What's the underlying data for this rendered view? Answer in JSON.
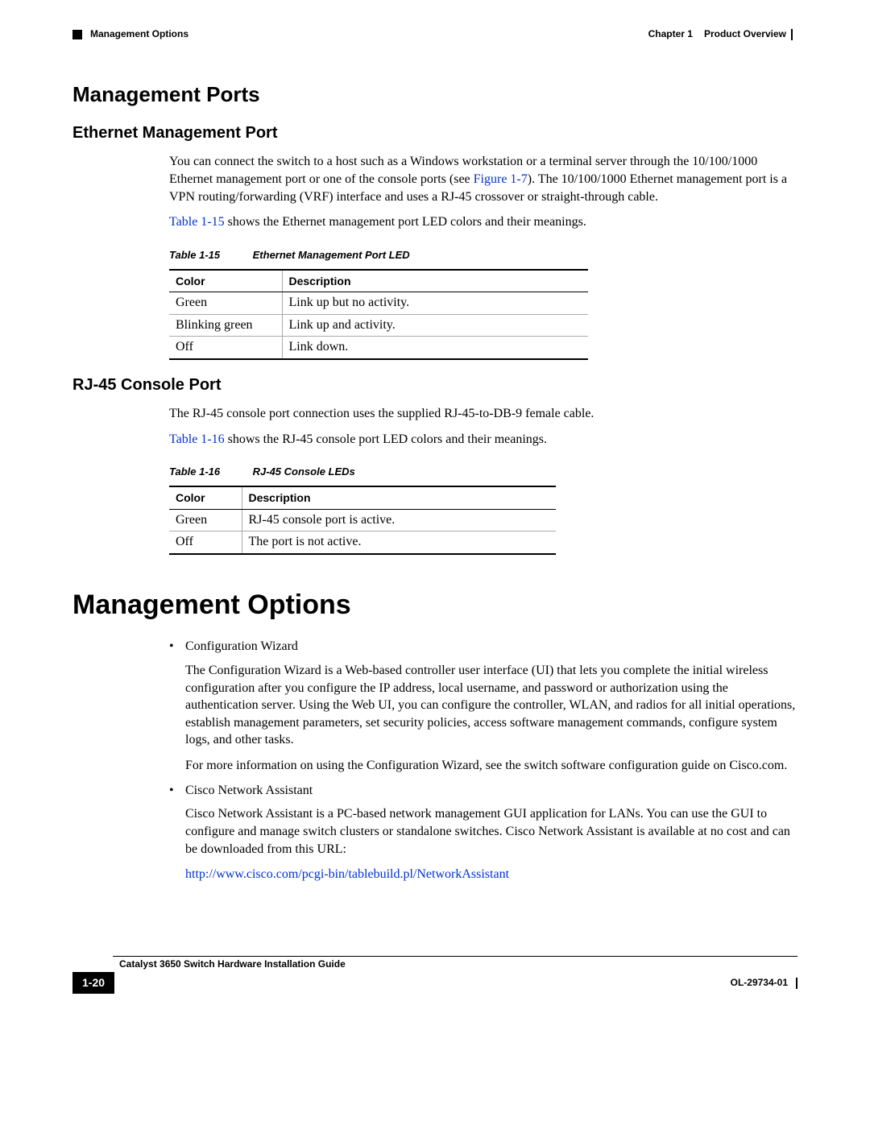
{
  "header": {
    "section": "Management Options",
    "chapter_label": "Chapter 1",
    "chapter_title": "Product Overview"
  },
  "h2_ports": "Management Ports",
  "h3_ethernet": "Ethernet Management Port",
  "ethernet": {
    "p1_a": "You can connect the switch to a host such as a Windows workstation or a terminal server through the 10/100/1000 Ethernet management port or one of the console ports (see ",
    "p1_link": "Figure 1-7",
    "p1_b": "). The 10/100/1000 Ethernet management port is a VPN routing/forwarding (VRF) interface and uses a RJ-45 crossover or straight-through cable.",
    "p2_link": "Table 1-15",
    "p2_b": " shows the Ethernet management port LED colors and their meanings."
  },
  "table15": {
    "caption_label": "Table 1-15",
    "caption_title": "Ethernet Management Port LED",
    "col1": "Color",
    "col2": "Description",
    "r1c1": "Green",
    "r1c2": "Link up but no activity.",
    "r2c1": "Blinking green",
    "r2c2": "Link up and activity.",
    "r3c1": "Off",
    "r3c2": "Link down."
  },
  "h3_rj45": "RJ-45 Console Port",
  "rj45": {
    "p1": "The RJ-45 console port connection uses the supplied RJ-45-to-DB-9 female cable.",
    "p2_link": "Table 1-16",
    "p2_b": " shows the RJ-45 console port LED colors and their meanings."
  },
  "table16": {
    "caption_label": "Table 1-16",
    "caption_title": "RJ-45 Console LEDs",
    "col1": "Color",
    "col2": "Description",
    "r1c1": "Green",
    "r1c2": "RJ-45 console port is active.",
    "r2c1": "Off",
    "r2c2": "The port is not active."
  },
  "h1_options": "Management Options",
  "options": {
    "b1_title": "Configuration Wizard",
    "b1_p1": "The Configuration Wizard is a Web-based controller user interface (UI) that lets you complete the initial wireless configuration after you configure the IP address, local username, and password or authorization using the authentication server. Using the Web UI, you can configure the controller, WLAN, and radios for all initial operations, establish management parameters, set security policies, access software management commands, configure system logs, and other tasks.",
    "b1_p2": "For more information on using the Configuration Wizard, see the switch software configuration guide on Cisco.com.",
    "b2_title": "Cisco Network Assistant",
    "b2_p1": "Cisco Network Assistant is a PC-based network management GUI application for LANs. You can use the GUI to configure and manage switch clusters or standalone switches. Cisco Network Assistant is available at no cost and can be downloaded from this URL:",
    "b2_link": "http://www.cisco.com/pcgi-bin/tablebuild.pl/NetworkAssistant"
  },
  "footer": {
    "guide": "Catalyst 3650 Switch Hardware Installation Guide",
    "page": "1-20",
    "docnum": "OL-29734-01"
  }
}
